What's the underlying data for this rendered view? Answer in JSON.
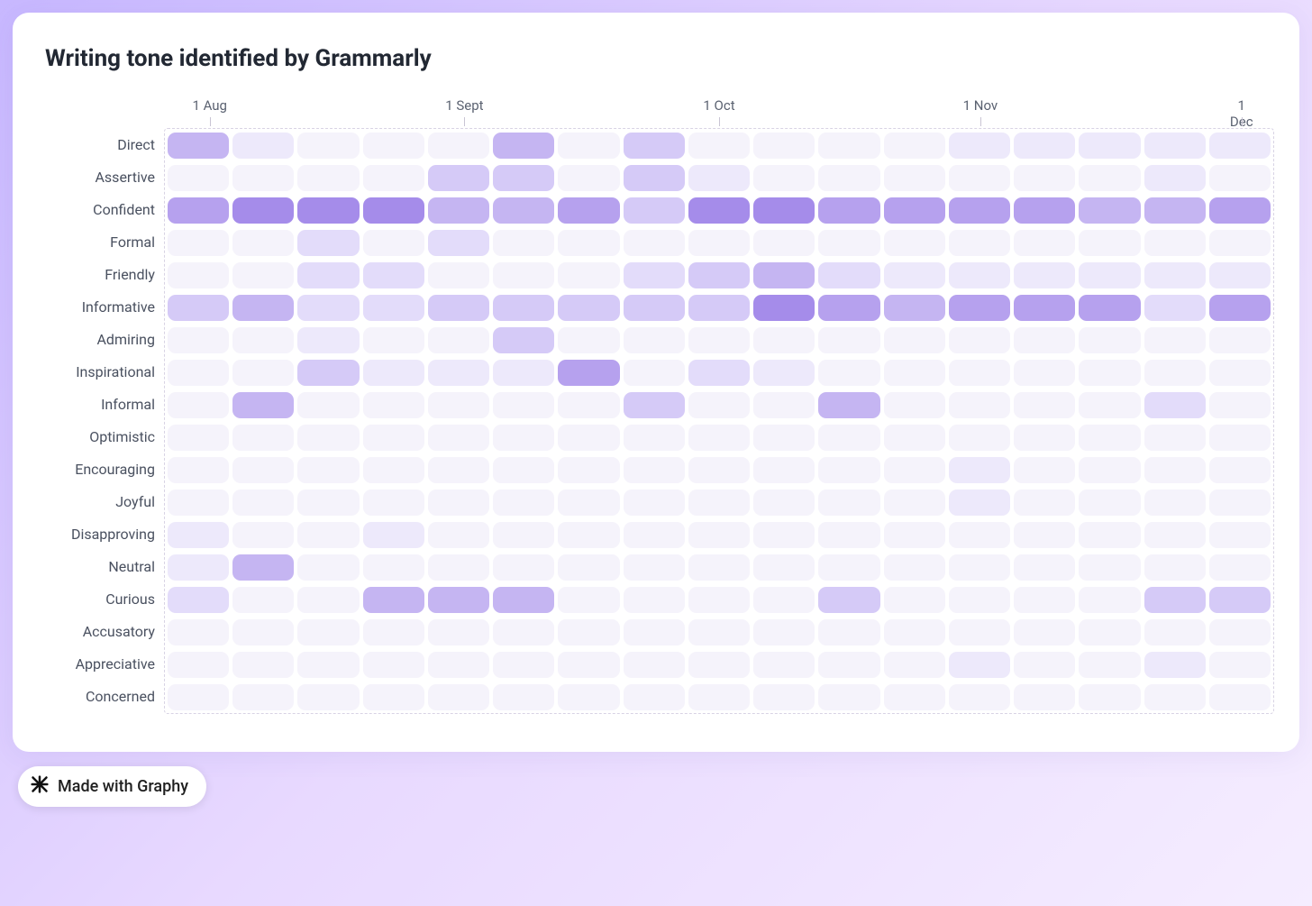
{
  "title": "Writing tone identified by Grammarly",
  "badge": "Made with Graphy",
  "color_scale": [
    "#f5f3fb",
    "#ede9fb",
    "#e3dcfa",
    "#d5caf7",
    "#c5b5f2",
    "#b6a1ee",
    "#a58cea"
  ],
  "chart_data": {
    "type": "heatmap",
    "title": "Writing tone identified by Grammarly",
    "xlabel": "",
    "ylabel": "",
    "x_ticks": [
      {
        "label": "1 Aug",
        "col_index": 0.7
      },
      {
        "label": "1 Sept",
        "col_index": 4.6
      },
      {
        "label": "1 Oct",
        "col_index": 8.5
      },
      {
        "label": "1 Nov",
        "col_index": 12.5
      },
      {
        "label": "1 Dec",
        "col_index": 16.5
      }
    ],
    "categories": [
      "Direct",
      "Assertive",
      "Confident",
      "Formal",
      "Friendly",
      "Informative",
      "Admiring",
      "Inspirational",
      "Informal",
      "Optimistic",
      "Encouraging",
      "Joyful",
      "Disapproving",
      "Neutral",
      "Curious",
      "Accusatory",
      "Appreciative",
      "Concerned"
    ],
    "n_cols": 17,
    "value_range": [
      0,
      6
    ],
    "grid": [
      [
        4,
        1,
        0,
        0,
        0,
        4,
        0,
        3,
        0,
        0,
        0,
        0,
        1,
        1,
        1,
        1,
        1
      ],
      [
        0,
        0,
        0,
        0,
        3,
        3,
        0,
        3,
        1,
        0,
        0,
        0,
        0,
        0,
        0,
        1,
        0
      ],
      [
        5,
        6,
        6,
        6,
        4,
        4,
        5,
        3,
        6,
        6,
        5,
        5,
        5,
        5,
        4,
        4,
        5
      ],
      [
        0,
        0,
        2,
        0,
        2,
        0,
        0,
        0,
        0,
        0,
        0,
        0,
        0,
        0,
        0,
        0,
        0
      ],
      [
        0,
        0,
        2,
        2,
        0,
        0,
        0,
        2,
        3,
        4,
        2,
        1,
        1,
        1,
        1,
        1,
        1
      ],
      [
        3,
        4,
        2,
        2,
        3,
        3,
        3,
        3,
        3,
        6,
        5,
        4,
        5,
        5,
        5,
        2,
        5
      ],
      [
        0,
        0,
        1,
        0,
        0,
        3,
        0,
        0,
        0,
        0,
        0,
        0,
        0,
        0,
        0,
        0,
        0
      ],
      [
        0,
        0,
        3,
        1,
        1,
        1,
        5,
        0,
        2,
        1,
        0,
        0,
        0,
        0,
        0,
        0,
        0
      ],
      [
        0,
        4,
        0,
        0,
        0,
        0,
        0,
        3,
        0,
        0,
        4,
        0,
        0,
        0,
        0,
        2,
        0
      ],
      [
        0,
        0,
        0,
        0,
        0,
        0,
        0,
        0,
        0,
        0,
        0,
        0,
        0,
        0,
        0,
        0,
        0
      ],
      [
        0,
        0,
        0,
        0,
        0,
        0,
        0,
        0,
        0,
        0,
        0,
        0,
        1,
        0,
        0,
        0,
        0
      ],
      [
        0,
        0,
        0,
        0,
        0,
        0,
        0,
        0,
        0,
        0,
        0,
        0,
        1,
        0,
        0,
        0,
        0
      ],
      [
        1,
        0,
        0,
        1,
        0,
        0,
        0,
        0,
        0,
        0,
        0,
        0,
        0,
        0,
        0,
        0,
        0
      ],
      [
        1,
        4,
        0,
        0,
        0,
        0,
        0,
        0,
        0,
        0,
        0,
        0,
        0,
        0,
        0,
        0,
        0
      ],
      [
        2,
        0,
        0,
        4,
        4,
        4,
        0,
        0,
        0,
        0,
        3,
        0,
        0,
        0,
        0,
        3,
        3
      ],
      [
        0,
        0,
        0,
        0,
        0,
        0,
        0,
        0,
        0,
        0,
        0,
        0,
        0,
        0,
        0,
        0,
        0
      ],
      [
        0,
        0,
        0,
        0,
        0,
        0,
        0,
        0,
        0,
        0,
        0,
        0,
        1,
        0,
        0,
        1,
        0
      ],
      [
        0,
        0,
        0,
        0,
        0,
        0,
        0,
        0,
        0,
        0,
        0,
        0,
        0,
        0,
        0,
        0,
        0
      ]
    ]
  }
}
